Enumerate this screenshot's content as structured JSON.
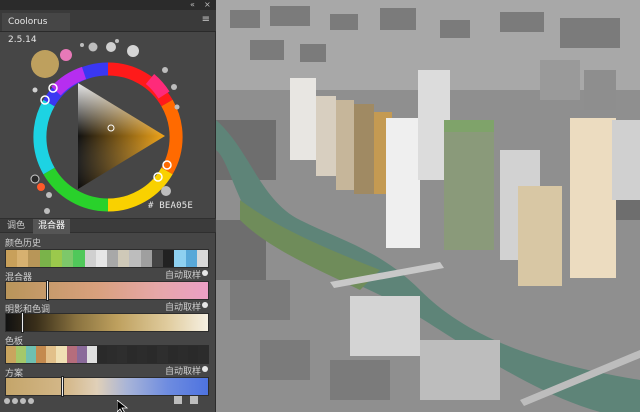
{
  "panel": {
    "title": "Coolorus 2.5.14"
  },
  "picker": {
    "hex": "# BEA05E",
    "current_color": "#BEA05E"
  },
  "tabs": [
    "调色",
    "混合器"
  ],
  "sections": {
    "history": {
      "label": "颜色历史",
      "colors": [
        "#c8a05a",
        "#d7b170",
        "#b89658",
        "#7ab34a",
        "#9bc94c",
        "#7dc86a",
        "#50c85a",
        "#d0d0d0",
        "#e6e6e6",
        "#a8a8a8",
        "#cfc9b8",
        "#bdbdbd",
        "#9f9f9f",
        "#444",
        "#222",
        "#8ed0f0",
        "#58a8d8",
        "#d9d9d9"
      ]
    },
    "mixer": {
      "label": "混合器",
      "auto": "自动取样"
    },
    "shades": {
      "label": "明影和色调",
      "auto": "自动取样"
    },
    "palette": {
      "label": "色板",
      "colors": [
        "#c9a55e",
        "#a4c86a",
        "#6fc0b0",
        "#c48a4e",
        "#e2c08a",
        "#f0e0b4",
        "#b56d7c",
        "#8a6a9a",
        "#e0e0e0",
        "#2a2a2a",
        "#2c2c2c",
        "#2e2e2e",
        "#2a2a2a",
        "#2c2c2c",
        "#2a2a2a",
        "#2e2e2e",
        "#2a2a2a",
        "#2c2c2c",
        "#2a2a2a",
        "#2c2c2c"
      ]
    },
    "scheme": {
      "label": "方案",
      "auto": "自动取样"
    }
  }
}
